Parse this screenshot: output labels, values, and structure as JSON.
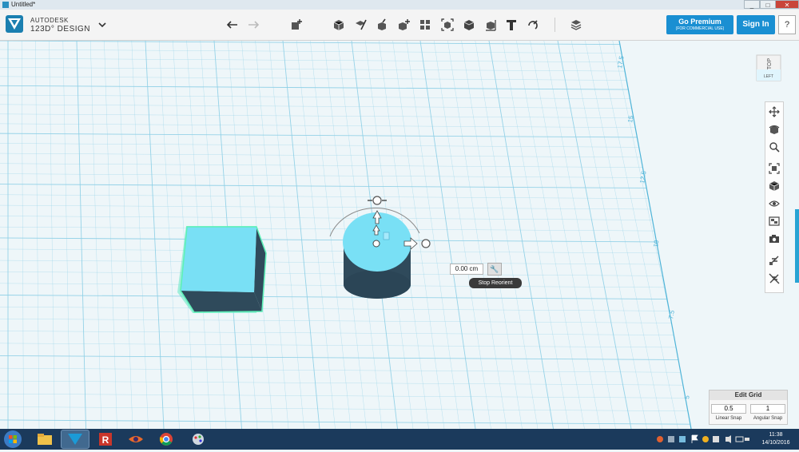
{
  "window": {
    "title": "Untitled*",
    "minimize": "_",
    "maximize": "□",
    "close": "✕"
  },
  "brand": {
    "line1": "AUTODESK",
    "line2": "123D° DESIGN"
  },
  "toolbar": {
    "icons": [
      "undo-icon",
      "redo-icon",
      "transform-icon",
      "primitives-icon",
      "sketch-icon",
      "construct-icon",
      "modify-icon",
      "pattern-icon",
      "grouping-icon",
      "combine-icon",
      "measure-icon",
      "text-icon",
      "snap-icon",
      "material-icon"
    ]
  },
  "header_buttons": {
    "premium": "Go Premium",
    "premium_sub": "(FOR COMMERCIAL USE)",
    "sign_in": "Sign In",
    "help": "?"
  },
  "viewcube": {
    "top": "TOP",
    "left": "LEFT"
  },
  "axis_labels": [
    "17.5",
    "15",
    "12.5",
    "10",
    "7.5",
    "5"
  ],
  "manipulator": {
    "value": "0.00 cm",
    "tooltip": "Stop Reorient"
  },
  "edit_grid": {
    "title": "Edit Grid",
    "linear_value": "0.5",
    "linear_label": "Linear Snap",
    "angular_value": "1",
    "angular_label": "Angular Snap"
  },
  "taskbar": {
    "time": "11:38",
    "date": "14/10/2016"
  },
  "colors": {
    "object": "#79e0f5",
    "object_dark": "#2f4a5b",
    "grid": "#8ccfe6",
    "accent": "#1a8fd2"
  }
}
